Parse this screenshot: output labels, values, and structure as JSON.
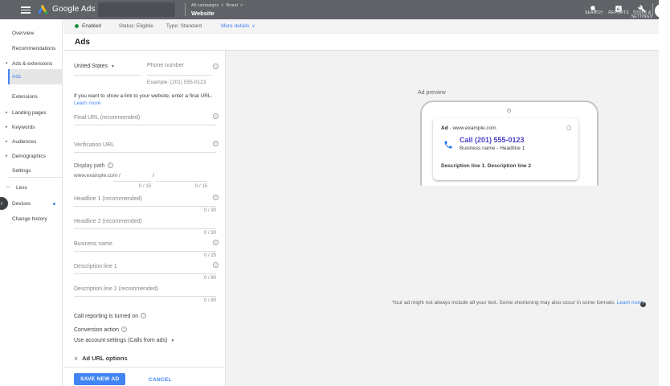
{
  "colors": {
    "topbar_bg": "#5f6267",
    "accent_blue": "#4285f4",
    "enabled_green": "#1e8e3e",
    "call_link_purple": "#4c3ec9",
    "preview_bg": "#f2f2f2",
    "save_button_bg": "#4285f4"
  },
  "icons": {
    "breadcrumb_separator": ">",
    "caret_down": "▾",
    "caret_right": "▸",
    "select_arrow": "▼",
    "chevron_down": "∨",
    "chevron_right": "›",
    "minus": "—",
    "help": "?",
    "middot": "·"
  },
  "topbar": {
    "brand": "Google Ads",
    "breadcrumb": {
      "item1": "All campaigns",
      "item2": "Brand",
      "current": "Website"
    },
    "actions": [
      {
        "label": "SEARCH"
      },
      {
        "label": "REPORTS"
      },
      {
        "label1": "TOOLS &",
        "label2": "SETTINGS"
      }
    ]
  },
  "statusbar": {
    "enabled": "Enabled",
    "status": "Status: Eligible",
    "type": "Type: Standard",
    "more_details": "More details"
  },
  "page_title": "Ads",
  "sidebar": {
    "items": [
      {
        "label": "Overview"
      },
      {
        "label": "Recommendations"
      },
      {
        "label": "Ads & extensions"
      },
      {
        "label": "Ads"
      },
      {
        "label": "Extensions"
      },
      {
        "label": "Landing pages"
      },
      {
        "label": "Keywords"
      },
      {
        "label": "Audiences"
      },
      {
        "label": "Demographics"
      },
      {
        "label": "Settings"
      },
      {
        "label": "Less"
      },
      {
        "label": "Devices"
      },
      {
        "label": "Change history"
      }
    ]
  },
  "form": {
    "country": {
      "value": "United States"
    },
    "phone": {
      "placeholder": "Phone number",
      "example": "Example: (201) 555-0123"
    },
    "website_note": "If you want to show a link to your website, enter a final URL.",
    "website_note_link": "Learn more",
    "final_url_label": "Final URL (recommended)",
    "verification_url_label": "Verification URL",
    "display_path_label": "Display path",
    "display_path_base": "www.example.com /",
    "display_path_separator": "/",
    "display_path_counter1": "0 / 15",
    "display_path_counter2": "0 / 15",
    "headline1_label": "Headline 1 (recommended)",
    "headline1_counter": "0 / 30",
    "headline2_label": "Headline 2 (recommended)",
    "headline2_counter": "0 / 30",
    "business_name_label": "Business name",
    "business_name_counter": "0 / 25",
    "description1_label": "Description line 1",
    "description1_counter": "0 / 90",
    "description2_label": "Description line 2 (recommended)",
    "description2_counter": "0 / 90",
    "call_reporting": "Call reporting is turned on",
    "conversion_action_label": "Conversion action",
    "conversion_action_value": "Use account settings (Calls from ads)",
    "ad_url_options": "Ad URL options",
    "save_button": "SAVE NEW AD",
    "cancel_button": "CANCEL"
  },
  "preview": {
    "label": "Ad preview",
    "ad_badge": "Ad",
    "display_url": "www.example.com",
    "call_headline": "Call (201) 555-0123",
    "subline": "Business name - Headline 1",
    "description": "Description line 1. Description line 2",
    "note": "Your ad might not always include all your text. Some shortening may also occur in some formats.",
    "note_link": "Learn more"
  }
}
